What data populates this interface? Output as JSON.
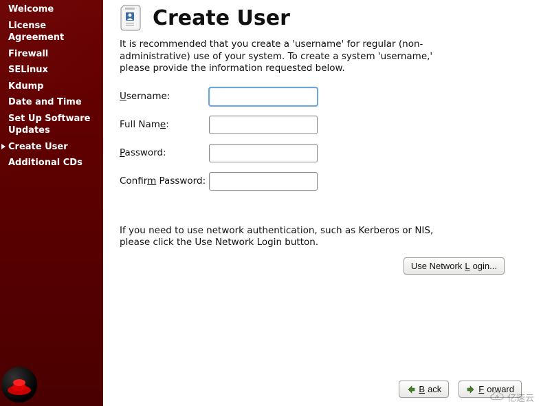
{
  "sidebar": {
    "items": [
      {
        "label": "Welcome"
      },
      {
        "label": "License Agreement"
      },
      {
        "label": "Firewall"
      },
      {
        "label": "SELinux"
      },
      {
        "label": "Kdump"
      },
      {
        "label": "Date and Time"
      },
      {
        "label": "Set Up Software Updates"
      },
      {
        "label": "Create User"
      },
      {
        "label": "Additional CDs"
      }
    ],
    "active_index": 7
  },
  "header": {
    "title": "Create User"
  },
  "intro_text": "It is recommended that you create a 'username' for regular (non-administrative) use of your system. To create a system 'username,' please provide the information requested below.",
  "form": {
    "username": {
      "label_pre": "U",
      "label_rest": "sername:",
      "value": ""
    },
    "fullname": {
      "label_pre": "Full Nam",
      "label_u": "e",
      "label_post": ":",
      "value": ""
    },
    "password": {
      "label_pre": "P",
      "label_rest": "assword:",
      "value": ""
    },
    "confirm": {
      "label_pre": "Confir",
      "label_u": "m",
      "label_post": " Password:",
      "value": ""
    }
  },
  "network_text": "If you need to use network authentication, such as Kerberos or NIS, please click the Use Network Login button.",
  "buttons": {
    "network_login_pre": "Use Network ",
    "network_login_u": "L",
    "network_login_post": "ogin...",
    "back_u": "B",
    "back_rest": "ack",
    "forward_u": "F",
    "forward_rest": "orward"
  },
  "watermark": "亿速云"
}
